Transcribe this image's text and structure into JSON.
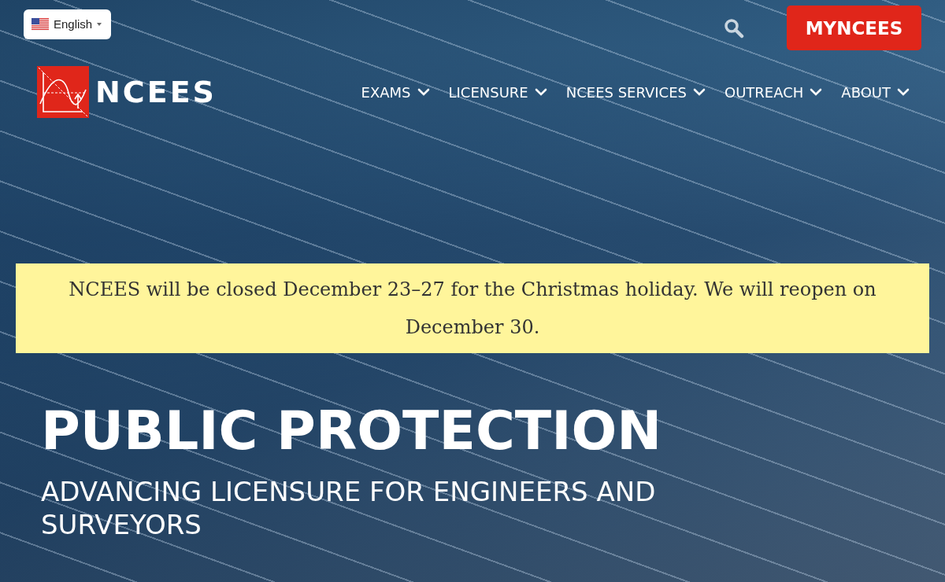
{
  "language_selector": {
    "label": "English"
  },
  "header": {
    "logo_text": "NCEES",
    "account_button": "MYNCEES"
  },
  "nav": [
    {
      "label": "EXAMS"
    },
    {
      "label": "LICENSURE"
    },
    {
      "label": "NCEES SERVICES"
    },
    {
      "label": "OUTREACH"
    },
    {
      "label": "ABOUT"
    }
  ],
  "notice": "NCEES will be closed December 23–27 for the Christmas holiday. We will reopen on December 30.",
  "hero": {
    "title": "PUBLIC PROTECTION",
    "subtitle": "ADVANCING LICENSURE FOR ENGINEERS AND SURVEYORS"
  }
}
